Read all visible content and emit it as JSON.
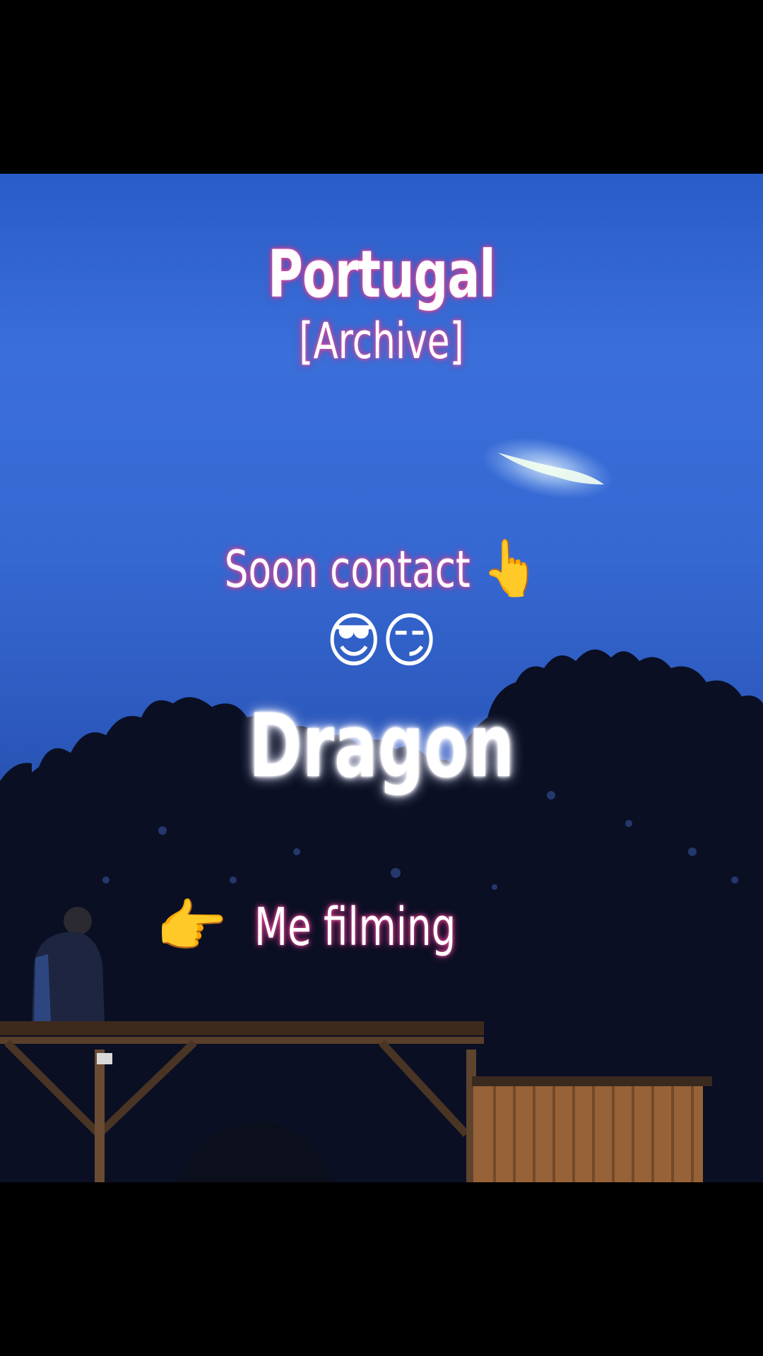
{
  "overlay": {
    "title": "Portugal",
    "subtitle": "[Archive]",
    "line_soon": "Soon contact",
    "line_soon_emoji": "👆",
    "faces": "😎😏",
    "headline": "Dragon",
    "pointer_emoji": "👉",
    "filming_label": "Me filming"
  },
  "colors": {
    "sky_top": "#2a5cc8",
    "sky_bottom": "#0c1530",
    "text_glow": "#ff4fa8",
    "letterbox": "#000000"
  }
}
